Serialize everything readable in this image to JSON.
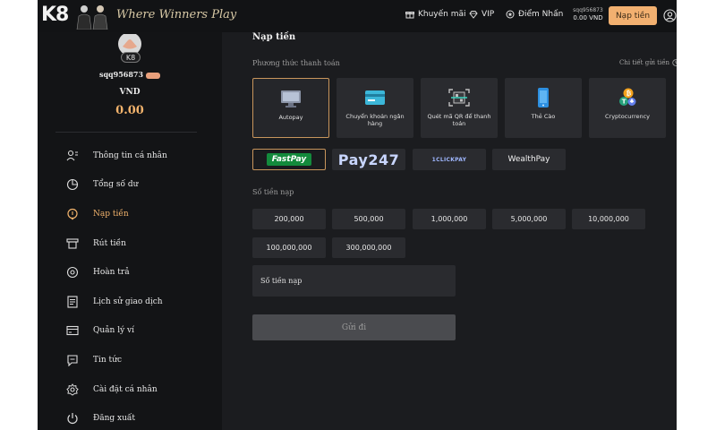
{
  "header": {
    "logo": "K8",
    "tagline": "Where Winners Play",
    "nav": [
      {
        "label": "Khuyến mãi",
        "icon": "gift-icon"
      },
      {
        "label": "VIP",
        "icon": "diamond-icon"
      },
      {
        "label": "Điểm Nhấn",
        "icon": "star-badge-icon"
      }
    ],
    "username": "sqq956873",
    "balance": "0.00 VND",
    "deposit_button": "Nạp tiền"
  },
  "sidebar": {
    "avatar_badge": "K8",
    "username": "sqq956873",
    "currency": "VND",
    "balance": "0.00",
    "items": [
      {
        "label": "Thông tin cá nhân",
        "icon": "user-list-icon",
        "active": false
      },
      {
        "label": "Tổng số dư",
        "icon": "wallet-chart-icon",
        "active": false
      },
      {
        "label": "Nạp tiền",
        "icon": "deposit-icon",
        "active": true
      },
      {
        "label": "Rút tiền",
        "icon": "withdraw-icon",
        "active": false
      },
      {
        "label": "Hoàn trả",
        "icon": "rebate-icon",
        "active": false
      },
      {
        "label": "Lịch sử giao dịch",
        "icon": "history-icon",
        "active": false
      },
      {
        "label": "Quản lý ví",
        "icon": "wallet-icon",
        "active": false
      },
      {
        "label": "Tin tức",
        "icon": "chat-icon",
        "active": false
      },
      {
        "label": "Cài đặt cá nhân",
        "icon": "settings-icon",
        "active": false
      },
      {
        "label": "Đăng xuất",
        "icon": "power-icon",
        "active": false
      }
    ]
  },
  "main": {
    "title": "Nạp tiền",
    "methods_label": "Phương thức thanh toán",
    "details_link": "Chi tiết gửi tiền",
    "methods": [
      {
        "label": "Autopay",
        "icon": "monitor-icon",
        "active": true
      },
      {
        "label": "Chuyển khoản ngân hàng",
        "icon": "bank-card-icon",
        "active": false
      },
      {
        "label": "Quét mã QR để thanh toán",
        "icon": "qr-scan-icon",
        "active": false
      },
      {
        "label": "Thẻ Cào",
        "icon": "phone-card-icon",
        "active": false
      },
      {
        "label": "Cryptocurrency",
        "icon": "crypto-coins-icon",
        "active": false
      }
    ],
    "providers": [
      {
        "label": "FastPay",
        "name": "fastpay"
      },
      {
        "label": "Pay247",
        "name": "pay247"
      },
      {
        "label": "1CLICKPAY",
        "name": "1clickpay"
      },
      {
        "label": "WealthPay",
        "name": "wealthpay"
      }
    ],
    "amount_label": "Số tiền nạp",
    "amounts": [
      "200,000",
      "500,000",
      "1,000,000",
      "5,000,000",
      "10,000,000",
      "100,000,000",
      "300,000,000"
    ],
    "amount_input_placeholder": "Số tiền nạp",
    "submit_label": "Gửi đi"
  },
  "colors": {
    "accent": "#f2b36c",
    "deposit_button": "#f2b070",
    "card_bg": "#2a2b2f",
    "active_border": "#c8955c"
  }
}
